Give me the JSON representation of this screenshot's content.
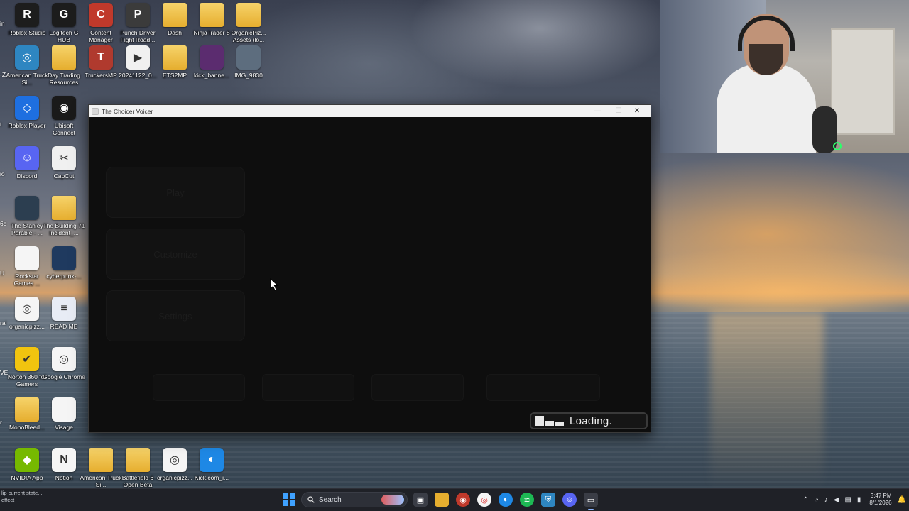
{
  "desktop": {
    "icons": [
      {
        "id": "roblox-studio",
        "label": "Roblox Studio",
        "color": "#1d1d1d",
        "glyph": "R"
      },
      {
        "id": "logitech",
        "label": "Logitech G HUB",
        "color": "#1c1c1c",
        "glyph": "G"
      },
      {
        "id": "content-manager",
        "label": "Content Manager",
        "color": "#c0392b",
        "glyph": "C"
      },
      {
        "id": "punch-driver",
        "label": "Punch Driver Fight Road...",
        "color": "#3b3b3b",
        "glyph": "P"
      },
      {
        "id": "dash",
        "label": "Dash",
        "color": "#e6ae2f",
        "glyph": ""
      },
      {
        "id": "ninjatrader",
        "label": "NinjaTrader 8",
        "color": "#e6ae2f",
        "glyph": ""
      },
      {
        "id": "organicpiz-assets",
        "label": "OrganicPiz... Assets (lo...",
        "color": "#e6ae2f",
        "glyph": ""
      },
      {
        "id": "american-truck",
        "label": "American Truck Si...",
        "color": "#2e86c1",
        "glyph": "◎"
      },
      {
        "id": "day-trading",
        "label": "Day Trading Resources",
        "color": "#e6ae2f",
        "glyph": ""
      },
      {
        "id": "truckersmp",
        "label": "TruckersMP",
        "color": "#b03a2e",
        "glyph": "T"
      },
      {
        "id": "video-2024",
        "label": "20241122_0...",
        "color": "#f0f0f0",
        "glyph": "▶"
      },
      {
        "id": "ets2mp",
        "label": "ETS2MP",
        "color": "#e6ae2f",
        "glyph": ""
      },
      {
        "id": "kick-banner",
        "label": "kick_banne...",
        "color": "#5b2c6f",
        "glyph": ""
      },
      {
        "id": "img-9830",
        "label": "IMG_9830",
        "color": "#5d6d7e",
        "glyph": ""
      },
      {
        "id": "roblox-player",
        "label": "Roblox Player",
        "color": "#1e6fe0",
        "glyph": "◇"
      },
      {
        "id": "ubisoft",
        "label": "Ubisoft Connect",
        "color": "#1a1a1a",
        "glyph": "◉"
      },
      {
        "id": "discord",
        "label": "Discord",
        "color": "#5865f2",
        "glyph": "☺"
      },
      {
        "id": "capcut",
        "label": "CapCut",
        "color": "#f0f0f0",
        "glyph": "✂"
      },
      {
        "id": "stanley-parable",
        "label": "The Stanley Parable - ...",
        "color": "#2c3e50",
        "glyph": ""
      },
      {
        "id": "building-71",
        "label": "The Building 71 Incident_...",
        "color": "#e6ae2f",
        "glyph": ""
      },
      {
        "id": "rockstar",
        "label": "Rockstar Games ...",
        "color": "#f5f5f5",
        "glyph": ""
      },
      {
        "id": "cyberpunk",
        "label": "cyberpunk-...",
        "color": "#1f3a5f",
        "glyph": ""
      },
      {
        "id": "organicpizz-chrome",
        "label": "organicpizz...",
        "color": "#f5f5f5",
        "glyph": "◎"
      },
      {
        "id": "readme",
        "label": "READ ME",
        "color": "#e8ecf5",
        "glyph": "≡"
      },
      {
        "id": "norton",
        "label": "Norton 360 for Gamers",
        "color": "#f1c40f",
        "glyph": "✔"
      },
      {
        "id": "google-chrome",
        "label": "Google Chrome",
        "color": "#f5f5f5",
        "glyph": "◎"
      },
      {
        "id": "monobleed",
        "label": "MonoBleed...",
        "color": "#e6ae2f",
        "glyph": ""
      },
      {
        "id": "visage",
        "label": "Visage",
        "color": "#f5f5f5",
        "glyph": ""
      },
      {
        "id": "nvidia",
        "label": "NVIDIA App",
        "color": "#76b900",
        "glyph": "◆"
      },
      {
        "id": "notion",
        "label": "Notion",
        "color": "#f5f5f5",
        "glyph": "N"
      },
      {
        "id": "american-truck-2",
        "label": "American Truck Si...",
        "color": "#e6ae2f",
        "glyph": ""
      },
      {
        "id": "battlefield6",
        "label": "Battlefield 6 Open Beta",
        "color": "#e6ae2f",
        "glyph": ""
      },
      {
        "id": "organicpizz-2",
        "label": "organicpizz...",
        "color": "#f5f5f5",
        "glyph": "◎"
      },
      {
        "id": "kick-com",
        "label": "Kick.com_i...",
        "color": "#1e88e5",
        "glyph": "◐"
      }
    ],
    "partial_labels": [
      "in",
      "-Z",
      "t",
      "io",
      "6c",
      "U",
      "ral",
      "VE",
      "r"
    ]
  },
  "app": {
    "title": "The Choicer Voicer",
    "buttons": [
      "Play",
      "Customize",
      "Settings"
    ],
    "loading_text": "Loading.",
    "minimize": "—",
    "maximize": "☐",
    "close": "✕"
  },
  "taskbar": {
    "tooltip_line1": "lip current state...",
    "tooltip_line2": "effect",
    "search_label": "Search",
    "time": "3:47 PM",
    "date": "8/1/2026"
  },
  "colors": {
    "accent": "#3fa2ff",
    "app_bg": "#0e0e0e",
    "loading_border": "#3a3a3a"
  }
}
